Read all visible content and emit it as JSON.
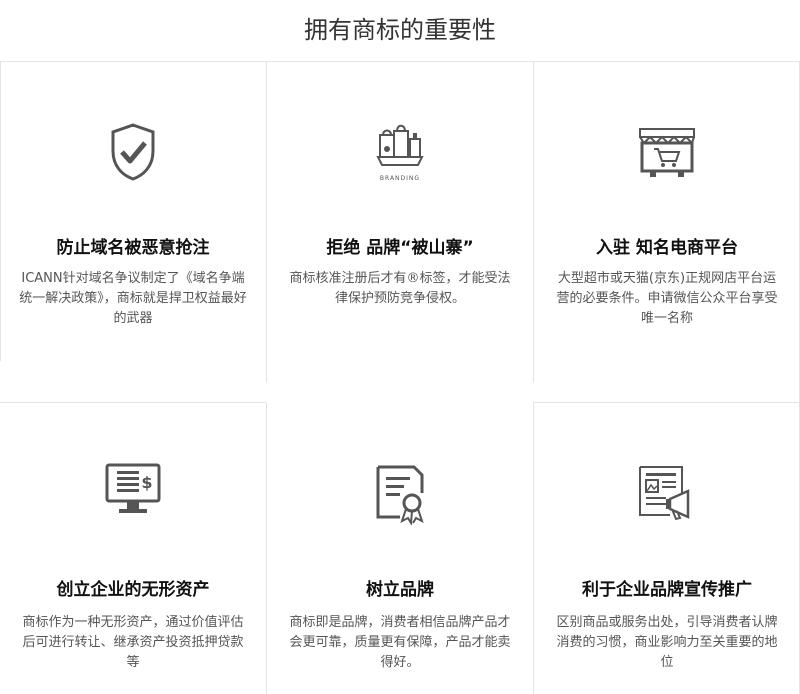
{
  "page": {
    "title": "拥有商标的重要性"
  },
  "cards": [
    {
      "title": "防止域名被恶意抢注",
      "desc": "ICANN针对域名争议制定了《域名争端统一解决政策》，商标就是捍卫权益最好的武器",
      "icon": "shield-check-icon"
    },
    {
      "title": "拒绝 品牌“被山寨”",
      "desc": "商标核准注册后才有®标签，才能受法律保护预防竞争侵权。",
      "icon": "branding-bags-icon",
      "icon_text": "BRANDING"
    },
    {
      "title": "入驻 知名电商平台",
      "desc": "大型超市或天猫(京东)正规网店平台运营的必要条件。申请微信公众平台享受唯一名称",
      "icon": "online-shop-icon"
    },
    {
      "title": "创立企业的无形资产",
      "desc": "商标作为一种无形资产，通过价值评估后可进行转让、继承资产投资抵押贷款等",
      "icon": "monitor-dollar-icon"
    },
    {
      "title": "树立品牌",
      "desc": "商标即是品牌，消费者相信品牌产品才会更可靠，质量更有保障，产品才能卖得好。",
      "icon": "certificate-icon"
    },
    {
      "title": "利于企业品牌宣传推广",
      "desc": "区别商品或服务出处，引导消费者认牌消费的习惯，商业影响力至关重要的地位",
      "icon": "newspaper-megaphone-icon"
    }
  ]
}
